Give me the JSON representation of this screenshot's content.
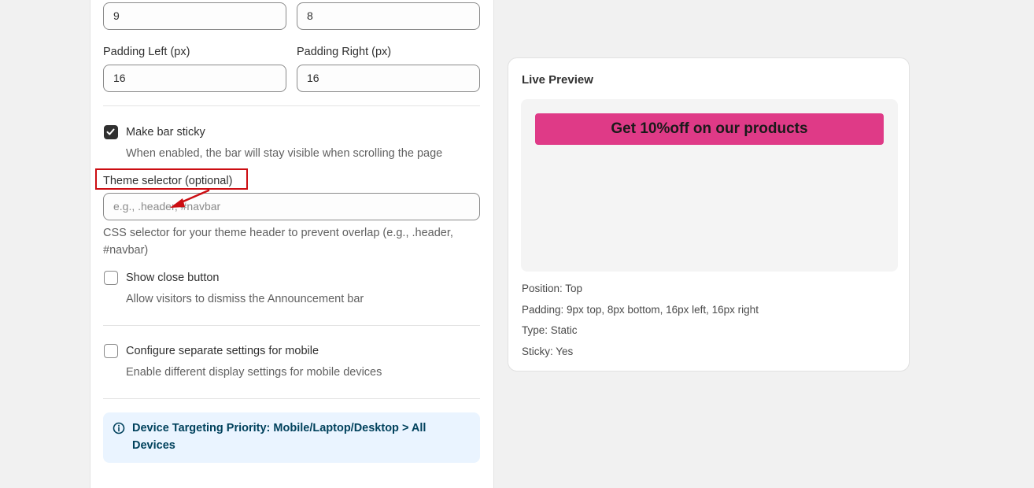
{
  "form": {
    "padding_top_value": "9",
    "padding_bottom_value": "8",
    "padding_left_label": "Padding Left (px)",
    "padding_left_value": "16",
    "padding_right_label": "Padding Right (px)",
    "padding_right_value": "16",
    "sticky_label": "Make bar sticky",
    "sticky_checked": true,
    "sticky_help": "When enabled, the bar will stay visible when scrolling the page",
    "theme_selector_label": "Theme selector (optional)",
    "theme_selector_placeholder": "e.g., .header, #navbar",
    "theme_selector_help_line1": "CSS selector for your theme header to prevent overlap (e.g., .header,",
    "theme_selector_help_line2": "#navbar)",
    "close_button_label": "Show close button",
    "close_button_checked": false,
    "close_button_help": "Allow visitors to dismiss the Announcement bar",
    "mobile_label": "Configure separate settings for mobile",
    "mobile_checked": false,
    "mobile_help": "Enable different display settings for mobile devices",
    "info_line1": "Device Targeting Priority: Mobile/Laptop/Desktop > All",
    "info_line2": "Devices"
  },
  "preview": {
    "title": "Live Preview",
    "bar_text": "Get 10%off on our products",
    "bar_color": "#df3a87",
    "position": "Position: Top",
    "padding": "Padding: 9px top, 8px bottom, 16px left, 16px right",
    "type": "Type: Static",
    "sticky": "Sticky: Yes"
  },
  "colors": {
    "annotation_red": "#cc0d12",
    "info_bg": "#eaf4ff",
    "info_text": "#00415c"
  },
  "icons": {
    "info": "info-circle-icon",
    "check": "checkmark-icon",
    "annotation_arrow": "red-arrow-icon"
  }
}
